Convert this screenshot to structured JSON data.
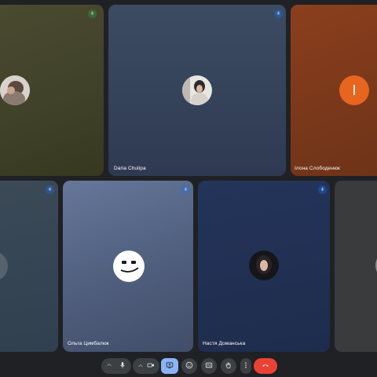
{
  "participants": [
    {
      "name": ""
    },
    {
      "name": "Daria Chulipa"
    },
    {
      "name": "Ілона Слободенюк",
      "initial": "І"
    },
    {
      "name": ""
    },
    {
      "name": "Ольга Цимбалюк"
    },
    {
      "name": "Настя Доманська"
    },
    {
      "name": ""
    }
  ],
  "colors": {
    "accent": "#8ab4f8",
    "end_call": "#ea4335",
    "avatar_orange": "#e8651f",
    "mic_blue": "#8ab4f8",
    "mic_green": "#34a853"
  },
  "icons": {
    "audio_settings": "chevron-up-icon",
    "mic": "mic-icon",
    "video_settings": "chevron-up-icon",
    "camera": "videocam-icon",
    "present": "present-screen-icon",
    "reactions": "emoji-icon",
    "captions": "captions-icon",
    "raise_hand": "hand-icon",
    "more": "more-vert-icon",
    "leave": "call-end-icon"
  }
}
